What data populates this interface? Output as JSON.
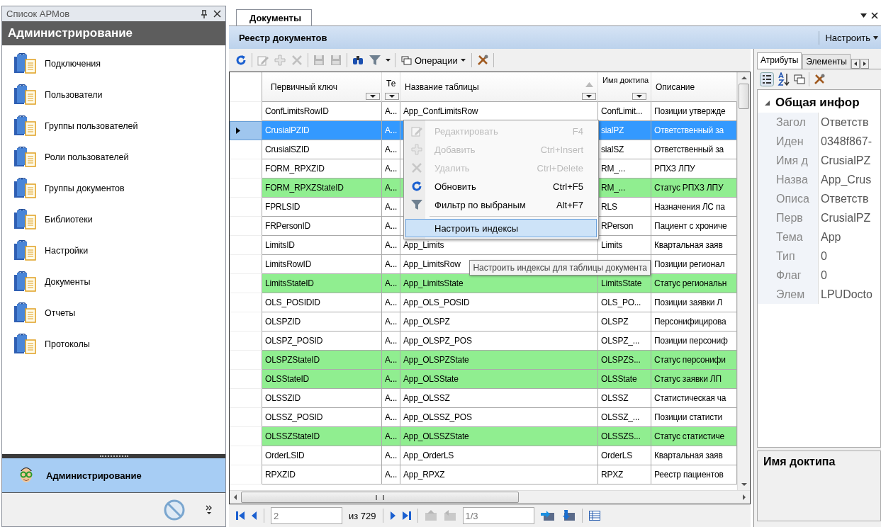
{
  "left_panel": {
    "title": "Список АРМов",
    "header": "Администрирование",
    "items": [
      {
        "label": "Подключения"
      },
      {
        "label": "Пользователи"
      },
      {
        "label": "Группы пользователей"
      },
      {
        "label": "Роли пользователей"
      },
      {
        "label": "Группы документов"
      },
      {
        "label": "Библиотеки"
      },
      {
        "label": "Настройки"
      },
      {
        "label": "Документы"
      },
      {
        "label": "Отчеты"
      },
      {
        "label": "Протоколы"
      }
    ],
    "workspaces": [
      {
        "label": "Администрирование",
        "selected": true
      }
    ]
  },
  "document_tab": {
    "label": "Документы",
    "selected": true
  },
  "registry": {
    "title": "Реестр документов",
    "configure": "Настроить"
  },
  "toolbar": [
    {
      "kind": "refresh",
      "disabled": false
    },
    {
      "kind": "separator"
    },
    {
      "kind": "edit",
      "disabled": true
    },
    {
      "kind": "add",
      "disabled": true
    },
    {
      "kind": "delete",
      "disabled": true
    },
    {
      "kind": "separator"
    },
    {
      "kind": "save",
      "disabled": true
    },
    {
      "kind": "save",
      "disabled": true
    },
    {
      "kind": "separator"
    },
    {
      "kind": "find",
      "disabled": false
    },
    {
      "kind": "filter",
      "disabled": false
    },
    {
      "kind": "separator"
    },
    {
      "kind": "operations",
      "label": "Операции",
      "disabled": false
    },
    {
      "kind": "separator"
    },
    {
      "kind": "tools",
      "disabled": false
    },
    {
      "kind": "separator"
    }
  ],
  "table": {
    "columns": [
      {
        "label": "Первичный ключ",
        "sorted": false
      },
      {
        "label": "Те",
        "sorted": false
      },
      {
        "label": "Название таблицы",
        "sorted": true
      },
      {
        "label": "Имя доктипа",
        "sorted": false
      },
      {
        "label": "Описание",
        "sorted": false
      }
    ],
    "rows": [
      {
        "key": "ConfLimitsRowID",
        "type": "A...",
        "table_name": "App_ConfLimitsRow",
        "doctype": "ConfLimit...",
        "description": "Позиции утвержде",
        "highlighted": false,
        "selected": false
      },
      {
        "key": "CrusialPZID",
        "type": "A...",
        "doctype": "sialPZ",
        "description": "Ответственный за",
        "highlighted": false,
        "selected": true
      },
      {
        "key": "CrusialSZID",
        "type": "A...",
        "doctype": "sialSZ",
        "description": "Ответственный за",
        "highlighted": false,
        "selected": false
      },
      {
        "key": "FORM_RPXZID",
        "type": "A...",
        "doctype": "RM_...",
        "description": "РПХЗ ЛПУ",
        "highlighted": false,
        "selected": false
      },
      {
        "key": "FORM_RPXZStateID",
        "type": "A...",
        "doctype": "RM_...",
        "description": "Статус РПХЗ ЛПУ",
        "highlighted": true,
        "selected": false
      },
      {
        "key": "FPRLSID",
        "type": "A...",
        "doctype": "RLS",
        "description": "Назначения ЛС па",
        "highlighted": false,
        "selected": false
      },
      {
        "key": "FRPersonID",
        "type": "A...",
        "doctype": "RPerson",
        "description": "Пациент с хрониче",
        "highlighted": false,
        "selected": false
      },
      {
        "key": "LimitsID",
        "type": "A...",
        "table_name": "App_Limits",
        "doctype": "Limits",
        "description": "Квартальная заяв",
        "highlighted": false,
        "selected": false
      },
      {
        "key": "LimitsRowID",
        "type": "A...",
        "table_name": "App_LimitsRow",
        "description": "Позиции регионал",
        "highlighted": false,
        "selected": false
      },
      {
        "key": "LimitsStateID",
        "type": "A...",
        "table_name": "App_LimitsState",
        "doctype": "LimitsState",
        "description": "Статус региональн",
        "highlighted": true,
        "selected": false
      },
      {
        "key": "OLS_POSIDID",
        "type": "A...",
        "table_name": "App_OLS_POSID",
        "doctype": "OLS_PO...",
        "description": "Позиции заявки Л",
        "highlighted": false,
        "selected": false
      },
      {
        "key": "OLSPZID",
        "type": "A...",
        "table_name": "App_OLSPZ",
        "doctype": "OLSPZ",
        "description": "Персонифицирова",
        "highlighted": false,
        "selected": false
      },
      {
        "key": "OLSPZ_POSID",
        "type": "A...",
        "table_name": "App_OLSPZ_POS",
        "doctype": "OLSPZ_...",
        "description": "Позиции персониф",
        "highlighted": false,
        "selected": false
      },
      {
        "key": "OLSPZStateID",
        "type": "A...",
        "table_name": "App_OLSPZState",
        "doctype": "OLSPZS...",
        "description": "Статус персонифи",
        "highlighted": true,
        "selected": false
      },
      {
        "key": "OLSStateID",
        "type": "A...",
        "table_name": "App_OLSState",
        "doctype": "OLSState",
        "description": "Статус заявки ЛП",
        "highlighted": true,
        "selected": false
      },
      {
        "key": "OLSSZID",
        "type": "A...",
        "table_name": "App_OLSSZ",
        "doctype": "OLSSZ",
        "description": "Статистическая ча",
        "highlighted": false,
        "selected": false
      },
      {
        "key": "OLSSZ_POSID",
        "type": "A...",
        "table_name": "App_OLSSZ_POS",
        "doctype": "OLSSZ_...",
        "description": "Позиции статисти",
        "highlighted": false,
        "selected": false
      },
      {
        "key": "OLSSZStateID",
        "type": "A...",
        "table_name": "App_OLSSZState",
        "doctype": "OLSSZS...",
        "description": "Статус статистиче",
        "highlighted": true,
        "selected": false
      },
      {
        "key": "OrderLSID",
        "type": "A...",
        "table_name": "App_OrderLS",
        "doctype": "OrderLS",
        "description": "Квартальная заяв",
        "highlighted": false,
        "selected": false
      },
      {
        "key": "RPXZID",
        "type": "A...",
        "table_name": "App_RPXZ",
        "doctype": "RPXZ",
        "description": "Реестр пациентов",
        "highlighted": false,
        "selected": false
      }
    ]
  },
  "pager": {
    "page": "2",
    "total": "из 729",
    "pages": "1/3"
  },
  "context_menu": [
    {
      "kind": "edit",
      "label": "Редактировать",
      "shortcut": "F4",
      "disabled": true,
      "selected": false
    },
    {
      "kind": "add",
      "label": "Добавить",
      "shortcut": "Ctrl+Insert",
      "disabled": true,
      "selected": false
    },
    {
      "kind": "delete",
      "label": "Удалить",
      "shortcut": "Ctrl+Delete",
      "disabled": true,
      "selected": false
    },
    {
      "kind": "refresh",
      "label": "Обновить",
      "shortcut": "Ctrl+F5",
      "disabled": false,
      "selected": false
    },
    {
      "kind": "filter",
      "label": "Фильтр по выбраным",
      "shortcut": "Alt+F7",
      "disabled": false,
      "selected": false
    },
    {
      "kind": "separator"
    },
    {
      "kind": "plain",
      "label": "Настроить индексы",
      "disabled": false,
      "selected": true
    }
  ],
  "tooltip": "Настроить индексы для таблицы документа",
  "properties": {
    "tabs": [
      {
        "label": "Атрибуты",
        "selected": true
      },
      {
        "label": "Элементы",
        "selected": false
      }
    ],
    "section": "Общая инфор",
    "rows": [
      {
        "name": "Загол",
        "value": "Ответств"
      },
      {
        "name": "Иден",
        "value": "0348f867-"
      },
      {
        "name": "Имя д",
        "value": "CrusialPZ"
      },
      {
        "name": "Назва",
        "value": "App_Crus"
      },
      {
        "name": "Описа",
        "value": "Ответств"
      },
      {
        "name": "Перв",
        "value": "CrusialPZ"
      },
      {
        "name": "Тема",
        "value": "App"
      },
      {
        "name": "Тип",
        "value": "0"
      },
      {
        "name": "Флаг",
        "value": "0"
      },
      {
        "name": "Элем",
        "value": "LPUDocto"
      }
    ],
    "description_title": "Имя доктипа"
  }
}
